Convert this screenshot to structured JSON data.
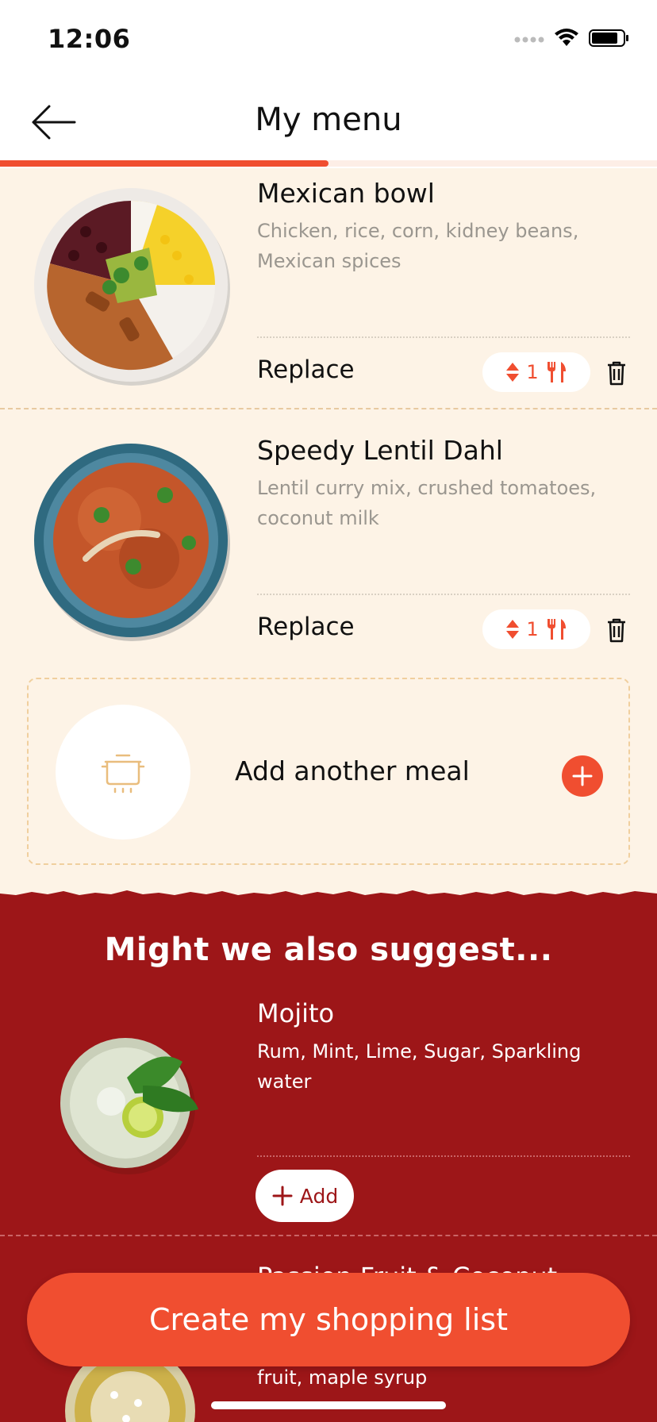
{
  "status_bar": {
    "time": "12:06"
  },
  "header": {
    "title": "My menu",
    "progress": 0.5
  },
  "meals": [
    {
      "title": "Mexican bowl",
      "description": "Chicken, rice, corn, kidney beans, Mexican spices",
      "replace_label": "Replace",
      "servings": "1"
    },
    {
      "title": "Speedy Lentil Dahl",
      "description": "Lentil curry mix, crushed tomatoes, coconut milk",
      "replace_label": "Replace",
      "servings": "1"
    }
  ],
  "add_meal": {
    "label": "Add another meal"
  },
  "suggestions": {
    "title": "Might we also suggest...",
    "items": [
      {
        "name": "Mojito",
        "description": "Rum, Mint, Lime, Sugar, Sparkling water",
        "add_label": "Add"
      },
      {
        "name": "Passion Fruit & Coconut",
        "description": "fruit, maple syrup"
      }
    ]
  },
  "cta": {
    "label": "Create my shopping list"
  },
  "colors": {
    "accent": "#f04e30",
    "brand_dark": "#9d1618",
    "background": "#fdf3e6"
  }
}
